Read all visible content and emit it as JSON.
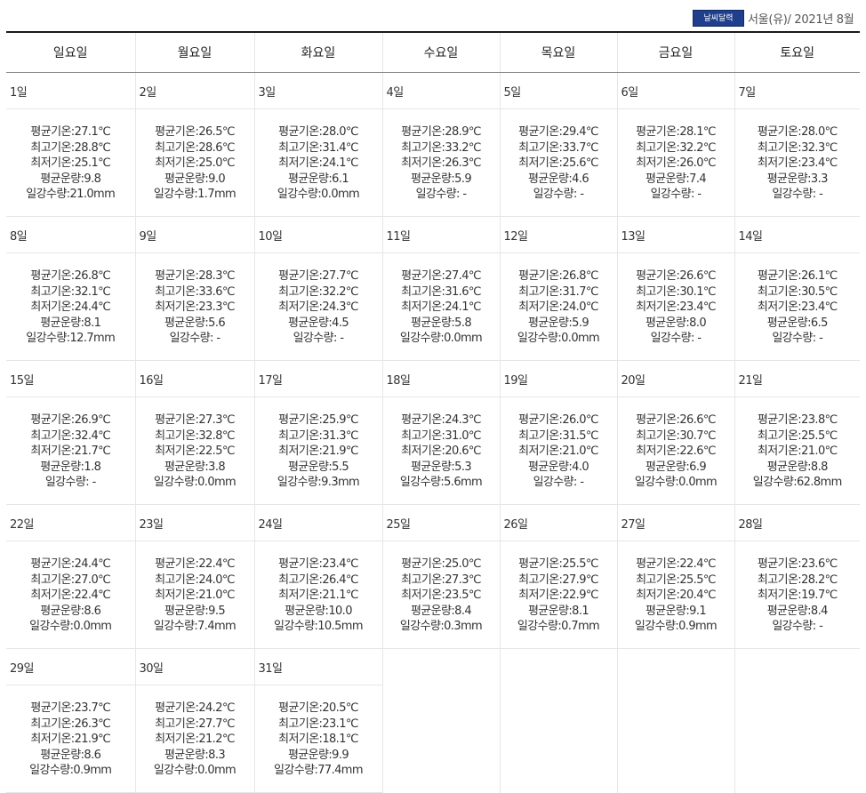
{
  "header": {
    "badge": "날씨달력",
    "location_date": "서울(유)/ 2021년 8월"
  },
  "labels": {
    "avg_temp": "평균기온:",
    "max_temp": "최고기온:",
    "min_temp": "최저기온:",
    "cloud": "평균운량:",
    "rain": "일강수량:"
  },
  "weekdays": [
    "일요일",
    "월요일",
    "화요일",
    "수요일",
    "목요일",
    "금요일",
    "토요일"
  ],
  "weeks": [
    [
      {
        "day": "1일",
        "avg": "27.1℃",
        "max": "28.8℃",
        "min": "25.1℃",
        "cloud": "9.8",
        "rain": "21.0mm"
      },
      {
        "day": "2일",
        "avg": "26.5℃",
        "max": "28.6℃",
        "min": "25.0℃",
        "cloud": "9.0",
        "rain": "1.7mm"
      },
      {
        "day": "3일",
        "avg": "28.0℃",
        "max": "31.4℃",
        "min": "24.1℃",
        "cloud": "6.1",
        "rain": "0.0mm"
      },
      {
        "day": "4일",
        "avg": "28.9℃",
        "max": "33.2℃",
        "min": "26.3℃",
        "cloud": "5.9",
        "rain": " -"
      },
      {
        "day": "5일",
        "avg": "29.4℃",
        "max": "33.7℃",
        "min": "25.6℃",
        "cloud": "4.6",
        "rain": " -"
      },
      {
        "day": "6일",
        "avg": "28.1℃",
        "max": "32.2℃",
        "min": "26.0℃",
        "cloud": "7.4",
        "rain": " -"
      },
      {
        "day": "7일",
        "avg": "28.0℃",
        "max": "32.3℃",
        "min": "23.4℃",
        "cloud": "3.3",
        "rain": " -"
      }
    ],
    [
      {
        "day": "8일",
        "avg": "26.8℃",
        "max": "32.1℃",
        "min": "24.4℃",
        "cloud": "8.1",
        "rain": "12.7mm"
      },
      {
        "day": "9일",
        "avg": "28.3℃",
        "max": "33.6℃",
        "min": "23.3℃",
        "cloud": "5.6",
        "rain": " -"
      },
      {
        "day": "10일",
        "avg": "27.7℃",
        "max": "32.2℃",
        "min": "24.3℃",
        "cloud": "4.5",
        "rain": " -"
      },
      {
        "day": "11일",
        "avg": "27.4℃",
        "max": "31.6℃",
        "min": "24.1℃",
        "cloud": "5.8",
        "rain": "0.0mm"
      },
      {
        "day": "12일",
        "avg": "26.8℃",
        "max": "31.7℃",
        "min": "24.0℃",
        "cloud": "5.9",
        "rain": "0.0mm"
      },
      {
        "day": "13일",
        "avg": "26.6℃",
        "max": "30.1℃",
        "min": "23.4℃",
        "cloud": "8.0",
        "rain": " -"
      },
      {
        "day": "14일",
        "avg": "26.1℃",
        "max": "30.5℃",
        "min": "23.4℃",
        "cloud": "6.5",
        "rain": " -"
      }
    ],
    [
      {
        "day": "15일",
        "avg": "26.9℃",
        "max": "32.4℃",
        "min": "21.7℃",
        "cloud": "1.8",
        "rain": " -"
      },
      {
        "day": "16일",
        "avg": "27.3℃",
        "max": "32.8℃",
        "min": "22.5℃",
        "cloud": "3.8",
        "rain": "0.0mm"
      },
      {
        "day": "17일",
        "avg": "25.9℃",
        "max": "31.3℃",
        "min": "21.9℃",
        "cloud": "5.5",
        "rain": "9.3mm"
      },
      {
        "day": "18일",
        "avg": "24.3℃",
        "max": "31.0℃",
        "min": "20.6℃",
        "cloud": "5.3",
        "rain": "5.6mm"
      },
      {
        "day": "19일",
        "avg": "26.0℃",
        "max": "31.5℃",
        "min": "21.0℃",
        "cloud": "4.0",
        "rain": " -"
      },
      {
        "day": "20일",
        "avg": "26.6℃",
        "max": "30.7℃",
        "min": "22.6℃",
        "cloud": "6.9",
        "rain": "0.0mm"
      },
      {
        "day": "21일",
        "avg": "23.8℃",
        "max": "25.5℃",
        "min": "21.0℃",
        "cloud": "8.8",
        "rain": "62.8mm"
      }
    ],
    [
      {
        "day": "22일",
        "avg": "24.4℃",
        "max": "27.0℃",
        "min": "22.4℃",
        "cloud": "8.6",
        "rain": "0.0mm"
      },
      {
        "day": "23일",
        "avg": "22.4℃",
        "max": "24.0℃",
        "min": "21.0℃",
        "cloud": "9.5",
        "rain": "7.4mm"
      },
      {
        "day": "24일",
        "avg": "23.4℃",
        "max": "26.4℃",
        "min": "21.1℃",
        "cloud": "10.0",
        "rain": "10.5mm"
      },
      {
        "day": "25일",
        "avg": "25.0℃",
        "max": "27.3℃",
        "min": "23.5℃",
        "cloud": "8.4",
        "rain": "0.3mm"
      },
      {
        "day": "26일",
        "avg": "25.5℃",
        "max": "27.9℃",
        "min": "22.9℃",
        "cloud": "8.1",
        "rain": "0.7mm"
      },
      {
        "day": "27일",
        "avg": "22.4℃",
        "max": "25.5℃",
        "min": "20.4℃",
        "cloud": "9.1",
        "rain": "0.9mm"
      },
      {
        "day": "28일",
        "avg": "23.6℃",
        "max": "28.2℃",
        "min": "19.7℃",
        "cloud": "8.4",
        "rain": " -"
      }
    ],
    [
      {
        "day": "29일",
        "avg": "23.7℃",
        "max": "26.3℃",
        "min": "21.9℃",
        "cloud": "8.6",
        "rain": "0.9mm"
      },
      {
        "day": "30일",
        "avg": "24.2℃",
        "max": "27.7℃",
        "min": "21.2℃",
        "cloud": "8.3",
        "rain": "0.0mm"
      },
      {
        "day": "31일",
        "avg": "20.5℃",
        "max": "23.1℃",
        "min": "18.1℃",
        "cloud": "9.9",
        "rain": "77.4mm"
      },
      null,
      null,
      null,
      null
    ]
  ]
}
